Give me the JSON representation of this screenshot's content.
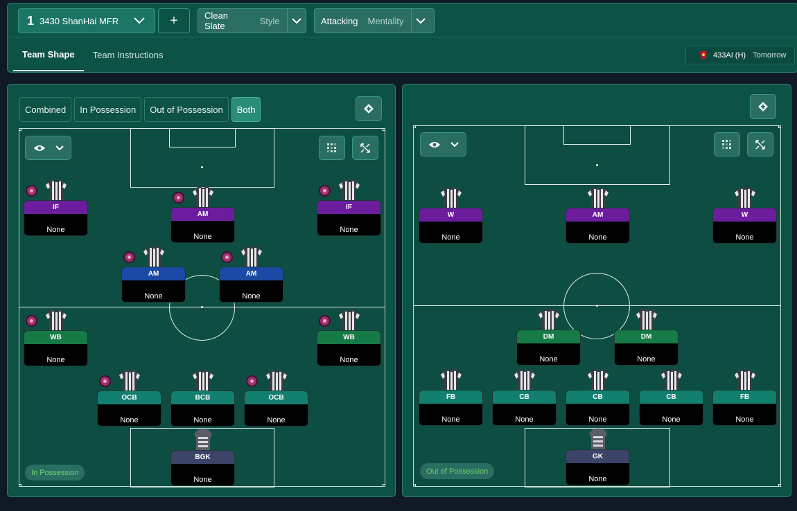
{
  "header": {
    "tactic_slot": "1",
    "tactic_name": "3430 ShanHai MFR",
    "add_label": "+",
    "style": {
      "value": "Clean Slate",
      "label": "Style"
    },
    "mentality": {
      "value": "Attacking",
      "label": "Mentality"
    },
    "tabs": [
      {
        "label": "Team Shape",
        "active": true
      },
      {
        "label": "Team Instructions",
        "active": false
      }
    ],
    "next_match": {
      "opponent": "433AI (H)",
      "when": "Tomorrow"
    }
  },
  "left_panel": {
    "filters": [
      {
        "label": "Combined",
        "active": false
      },
      {
        "label": "In Possession",
        "active": false
      },
      {
        "label": "Out of Possession",
        "active": false
      },
      {
        "label": "Both",
        "active": true
      }
    ],
    "phase_badge": "In Possession",
    "players": [
      {
        "role": "IF",
        "duty": "None",
        "color": "purple",
        "badge": true
      },
      {
        "role": "AM",
        "duty": "None",
        "color": "purple",
        "badge": true
      },
      {
        "role": "IF",
        "duty": "None",
        "color": "purple",
        "badge": true
      },
      {
        "role": "AM",
        "duty": "None",
        "color": "blue",
        "badge": true
      },
      {
        "role": "AM",
        "duty": "None",
        "color": "blue",
        "badge": true
      },
      {
        "role": "WB",
        "duty": "None",
        "color": "green",
        "badge": true
      },
      {
        "role": "WB",
        "duty": "None",
        "color": "green",
        "badge": true
      },
      {
        "role": "OCB",
        "duty": "None",
        "color": "teal",
        "badge": true
      },
      {
        "role": "BCB",
        "duty": "None",
        "color": "teal",
        "badge": false
      },
      {
        "role": "OCB",
        "duty": "None",
        "color": "teal",
        "badge": true
      },
      {
        "role": "BGK",
        "duty": "None",
        "color": "slate",
        "badge": false
      }
    ]
  },
  "right_panel": {
    "phase_badge": "Out of Possession",
    "players": [
      {
        "role": "W",
        "duty": "None",
        "color": "purple"
      },
      {
        "role": "AM",
        "duty": "None",
        "color": "purple"
      },
      {
        "role": "W",
        "duty": "None",
        "color": "purple"
      },
      {
        "role": "DM",
        "duty": "None",
        "color": "green"
      },
      {
        "role": "DM",
        "duty": "None",
        "color": "green"
      },
      {
        "role": "FB",
        "duty": "None",
        "color": "teal"
      },
      {
        "role": "CB",
        "duty": "None",
        "color": "teal"
      },
      {
        "role": "CB",
        "duty": "None",
        "color": "teal"
      },
      {
        "role": "CB",
        "duty": "None",
        "color": "teal"
      },
      {
        "role": "FB",
        "duty": "None",
        "color": "teal"
      },
      {
        "role": "GK",
        "duty": "None",
        "color": "slate"
      }
    ]
  },
  "icons": {
    "chevron": "chevron-down-icon",
    "eye": "eye-icon",
    "grid": "grid-icon",
    "expand": "expand-icon",
    "swap": "swap-icon",
    "crest": "club-crest-icon",
    "shirt": "shirt-icon"
  },
  "colors": {
    "purple": "#6b1d9e",
    "blue": "#1a4aa3",
    "green": "#157a45",
    "teal": "#13806f",
    "slate": "#3b4367",
    "panel_bg": "#0c5245",
    "pitch_bg": "#0e4e42",
    "phase_text": "#70d46c"
  }
}
